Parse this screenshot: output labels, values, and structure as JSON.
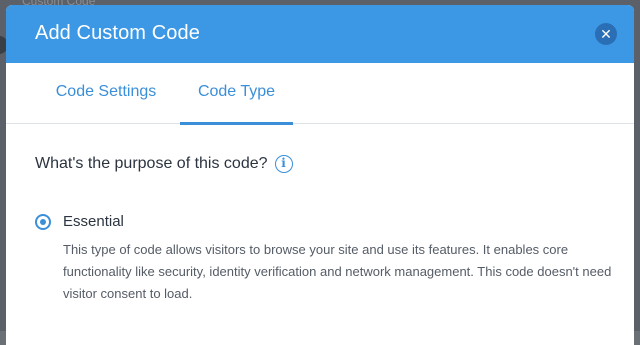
{
  "background": {
    "peek_text": "Custom Code"
  },
  "dialog": {
    "title": "Add Custom Code",
    "close_icon": "close-icon",
    "tabs": [
      {
        "label": "Code Settings",
        "active": false
      },
      {
        "label": "Code Type",
        "active": true
      }
    ],
    "question": "What's the purpose of this code?",
    "info_icon": "info-icon",
    "option": {
      "label": "Essential",
      "selected": true,
      "description": "This type of code allows visitors to browse your site and use its features. It enables core functionality like security, identity verification and network management. This code doesn't need visitor consent to load."
    }
  },
  "colors": {
    "header": "#3c98e4",
    "accent": "#3b8fd8",
    "text": "#2b3440",
    "muted_text": "#555c66"
  }
}
